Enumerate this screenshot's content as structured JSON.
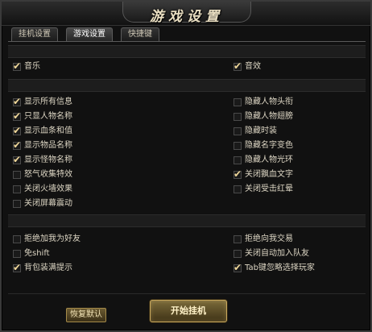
{
  "window": {
    "title": "游戏设置"
  },
  "tabs": [
    {
      "label": "挂机设置",
      "active": false
    },
    {
      "label": "游戏设置",
      "active": true
    },
    {
      "label": "快捷键",
      "active": false
    }
  ],
  "sound": {
    "music": {
      "label": "音乐",
      "checked": true
    },
    "effects": {
      "label": "音效",
      "checked": true
    }
  },
  "display_left": [
    {
      "label": "显示所有信息",
      "checked": true
    },
    {
      "label": "只显人物名称",
      "checked": true
    },
    {
      "label": "显示血条和值",
      "checked": true
    },
    {
      "label": "显示物品名称",
      "checked": true
    },
    {
      "label": "显示怪物名称",
      "checked": true
    },
    {
      "label": "怒气收集特效",
      "checked": false
    },
    {
      "label": "关闭火墙效果",
      "checked": false
    },
    {
      "label": "关闭屏幕震动",
      "checked": false
    }
  ],
  "display_right": [
    {
      "label": "隐藏人物头衔",
      "checked": false
    },
    {
      "label": "隐藏人物翅膀",
      "checked": false
    },
    {
      "label": "隐藏时装",
      "checked": false
    },
    {
      "label": "隐藏名字变色",
      "checked": false
    },
    {
      "label": "隐藏人物光环",
      "checked": false
    },
    {
      "label": "关闭飘血文字",
      "checked": true
    },
    {
      "label": "关闭受击红晕",
      "checked": false
    }
  ],
  "social_left": [
    {
      "label": "拒绝加我为好友",
      "checked": false
    },
    {
      "label": "免shift",
      "checked": false
    },
    {
      "label": "背包装满提示",
      "checked": true
    }
  ],
  "social_right": [
    {
      "label": "拒绝向我交易",
      "checked": false
    },
    {
      "label": "关闭自动加入队友",
      "checked": false
    },
    {
      "label": "Tab键忽略选择玩家",
      "checked": true
    }
  ],
  "buttons": {
    "reset": "恢复默认",
    "start": "开始挂机"
  },
  "colors": {
    "check": "#f0d89a",
    "button_border": "#c9a85c"
  }
}
